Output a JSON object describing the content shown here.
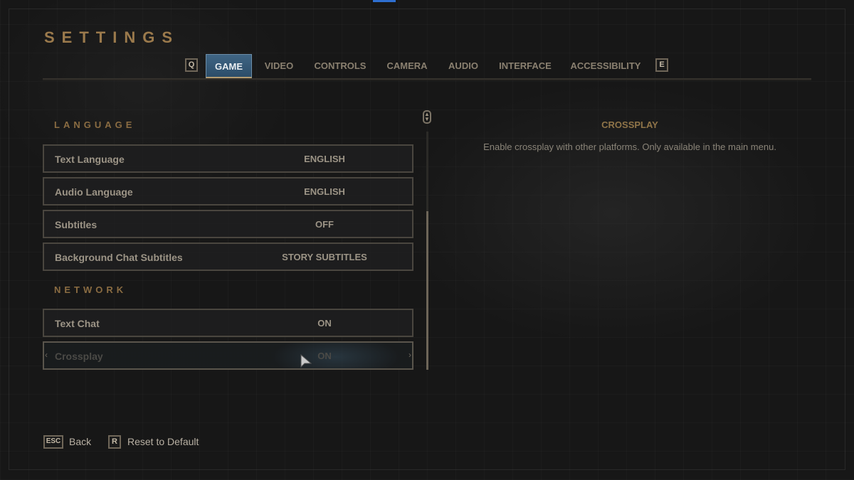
{
  "header": {
    "title": "SETTINGS",
    "prev_tab_key": "Q",
    "next_tab_key": "E",
    "tabs": [
      {
        "label": "GAME",
        "active": true
      },
      {
        "label": "VIDEO",
        "active": false
      },
      {
        "label": "CONTROLS",
        "active": false
      },
      {
        "label": "CAMERA",
        "active": false
      },
      {
        "label": "AUDIO",
        "active": false
      },
      {
        "label": "INTERFACE",
        "active": false
      },
      {
        "label": "ACCESSIBILITY",
        "active": false
      }
    ]
  },
  "sections": [
    {
      "title": "LANGUAGE",
      "rows": [
        {
          "label": "Text Language",
          "value": "ENGLISH"
        },
        {
          "label": "Audio Language",
          "value": "ENGLISH"
        },
        {
          "label": "Subtitles",
          "value": "OFF"
        },
        {
          "label": "Background Chat Subtitles",
          "value": "STORY SUBTITLES"
        }
      ]
    },
    {
      "title": "NETWORK",
      "rows": [
        {
          "label": "Text Chat",
          "value": "ON"
        },
        {
          "label": "Crossplay",
          "value": "ON",
          "focused": true,
          "disabled": true
        }
      ]
    }
  ],
  "description": {
    "title": "CROSSPLAY",
    "text": "Enable crossplay with other platforms. Only available in the main menu."
  },
  "footer": {
    "back_key": "ESC",
    "back_label": "Back",
    "reset_key": "R",
    "reset_label": "Reset to Default"
  },
  "icons": {
    "scroll": "scroll-updown-icon",
    "row_arrow_left": "‹",
    "row_arrow_right": "›"
  },
  "colors": {
    "accent_gold": "#9b7a4c",
    "active_tab": "#3f6584",
    "text": "#9c9486"
  }
}
